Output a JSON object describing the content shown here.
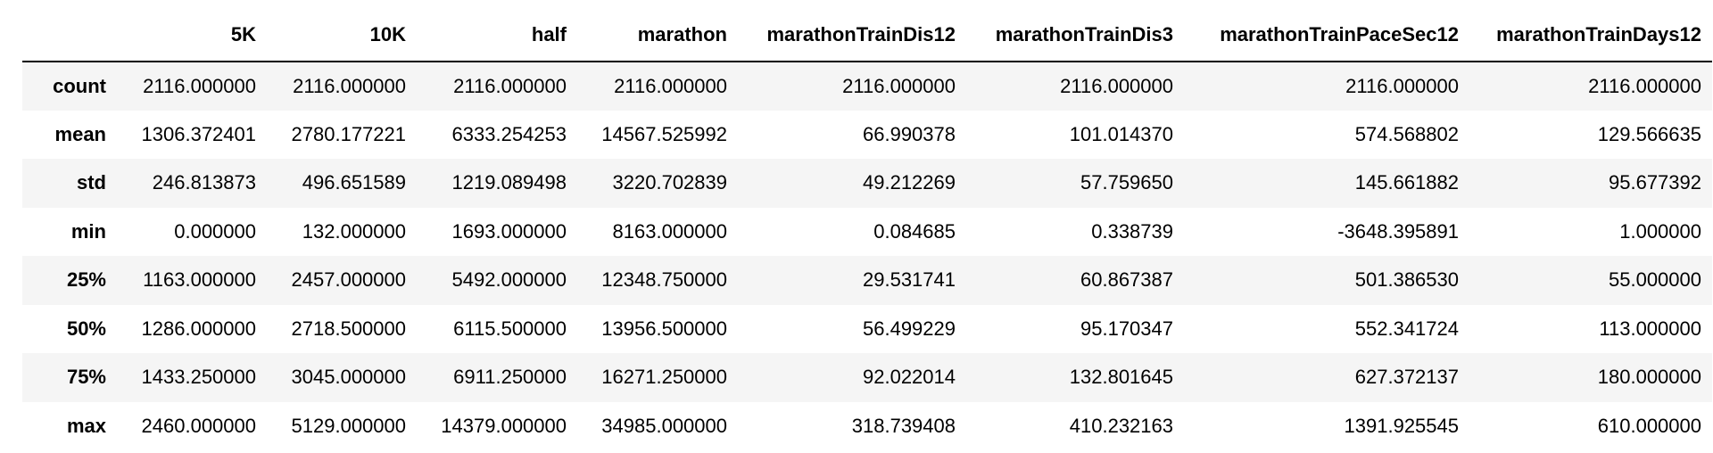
{
  "table": {
    "index_header": "",
    "columns": [
      "5K",
      "10K",
      "half",
      "marathon",
      "marathonTrainDis12",
      "marathonTrainDis3",
      "marathonTrainPaceSec12",
      "marathonTrainDays12"
    ],
    "rows": [
      {
        "label": "count",
        "values": [
          "2116.000000",
          "2116.000000",
          "2116.000000",
          "2116.000000",
          "2116.000000",
          "2116.000000",
          "2116.000000",
          "2116.000000"
        ]
      },
      {
        "label": "mean",
        "values": [
          "1306.372401",
          "2780.177221",
          "6333.254253",
          "14567.525992",
          "66.990378",
          "101.014370",
          "574.568802",
          "129.566635"
        ]
      },
      {
        "label": "std",
        "values": [
          "246.813873",
          "496.651589",
          "1219.089498",
          "3220.702839",
          "49.212269",
          "57.759650",
          "145.661882",
          "95.677392"
        ]
      },
      {
        "label": "min",
        "values": [
          "0.000000",
          "132.000000",
          "1693.000000",
          "8163.000000",
          "0.084685",
          "0.338739",
          "-3648.395891",
          "1.000000"
        ]
      },
      {
        "label": "25%",
        "values": [
          "1163.000000",
          "2457.000000",
          "5492.000000",
          "12348.750000",
          "29.531741",
          "60.867387",
          "501.386530",
          "55.000000"
        ]
      },
      {
        "label": "50%",
        "values": [
          "1286.000000",
          "2718.500000",
          "6115.500000",
          "13956.500000",
          "56.499229",
          "95.170347",
          "552.341724",
          "113.000000"
        ]
      },
      {
        "label": "75%",
        "values": [
          "1433.250000",
          "3045.000000",
          "6911.250000",
          "16271.250000",
          "92.022014",
          "132.801645",
          "627.372137",
          "180.000000"
        ]
      },
      {
        "label": "max",
        "values": [
          "2460.000000",
          "5129.000000",
          "14379.000000",
          "34985.000000",
          "318.739408",
          "410.232163",
          "1391.925545",
          "610.000000"
        ]
      }
    ]
  },
  "colors": {
    "stripe": "#f5f5f5",
    "background": "#ffffff",
    "text": "#000000",
    "header_rule": "#000000"
  }
}
